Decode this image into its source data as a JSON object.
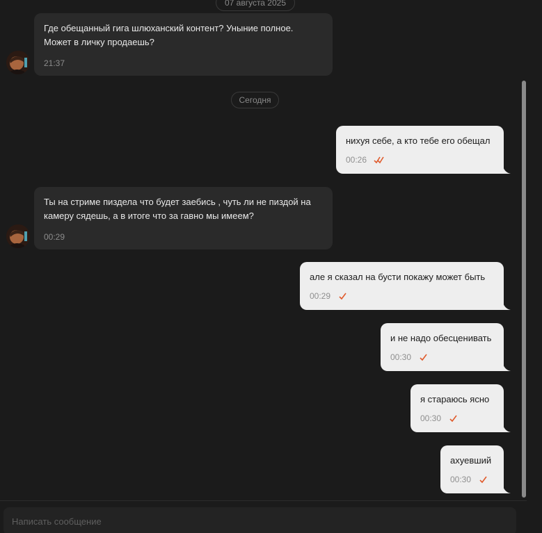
{
  "dates": {
    "top": "07 августа 2025",
    "today": "Сегодня"
  },
  "messages": [
    {
      "direction": "in",
      "text": "Где обещанный гига шлюханский контент? Уныние полное. Может в личку продаешь?",
      "time": "21:37"
    },
    {
      "direction": "out",
      "text": "нихуя себе, а кто тебе его обещал",
      "time": "00:26",
      "status": "read"
    },
    {
      "direction": "in",
      "text": "Ты на стриме пиздела что будет заебись , чуть ли не пиздой на камеру сядешь, а в итоге что за гавно мы имеем?",
      "time": "00:29"
    },
    {
      "direction": "out",
      "text": "але я сказал на бусти покажу может быть",
      "time": "00:29",
      "status": "sent"
    },
    {
      "direction": "out",
      "text": "и не надо обесценивать",
      "time": "00:30",
      "status": "sent"
    },
    {
      "direction": "out",
      "text": "я стараюсь ясно",
      "time": "00:30",
      "status": "sent"
    },
    {
      "direction": "out",
      "text": "ахуевший",
      "time": "00:30",
      "status": "sent"
    }
  ],
  "composer": {
    "placeholder": "Написать сообщение",
    "value": ""
  },
  "icons": {
    "read_status": "double-check-icon",
    "sent_status": "check-icon",
    "avatar": "contact-avatar"
  },
  "colors": {
    "background": "#1b1b1b",
    "incoming_bubble": "#2a2a2a",
    "outgoing_bubble": "#eeeeee",
    "check_mark": "#e05a2b"
  }
}
